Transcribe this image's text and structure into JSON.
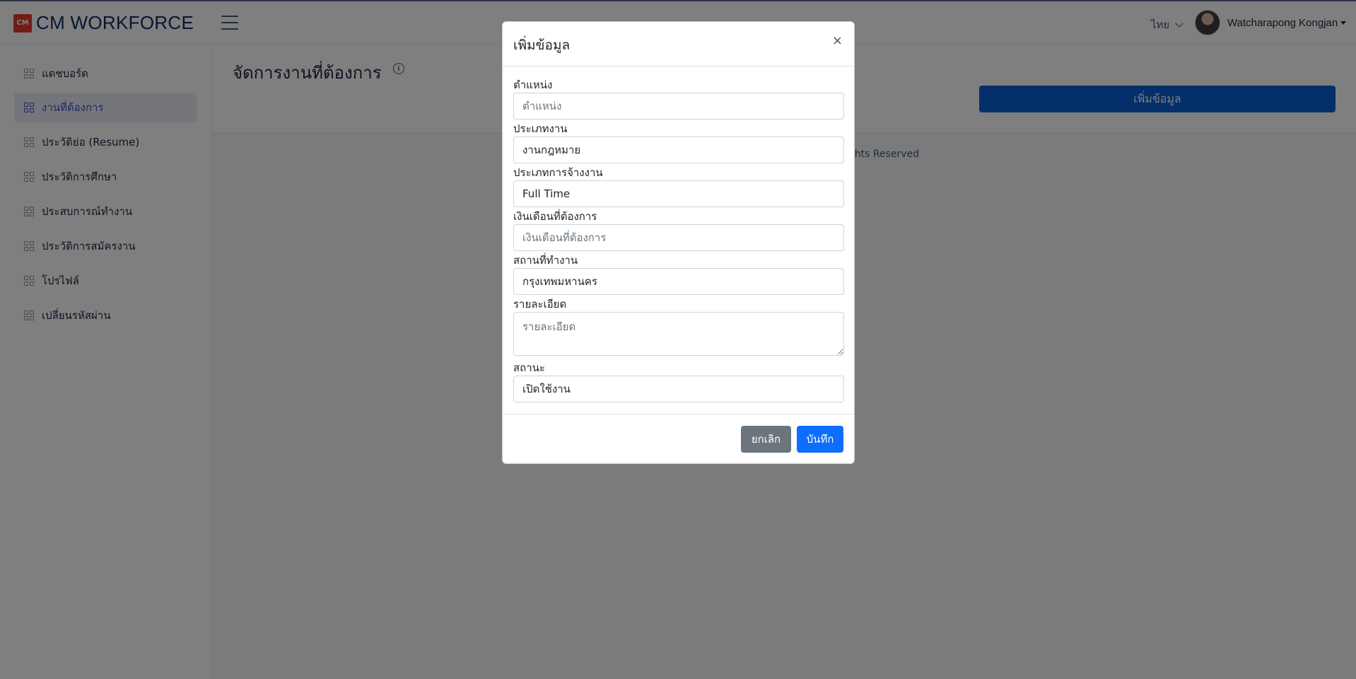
{
  "header": {
    "brand_logo": "CM",
    "brand_name": "CM WORKFORCE",
    "language": "ไทย",
    "user_name": "Watcharapong Kongjan"
  },
  "sidebar": {
    "items": [
      {
        "label": "แดชบอร์ด",
        "active": false
      },
      {
        "label": "งานที่ต้องการ",
        "active": true
      },
      {
        "label": "ประวัติย่อ (Resume)",
        "active": false
      },
      {
        "label": "ประวัติการศึกษา",
        "active": false
      },
      {
        "label": "ประสบการณ์ทำงาน",
        "active": false
      },
      {
        "label": "ประวัติการสมัครงาน",
        "active": false
      },
      {
        "label": "โปรไฟล์",
        "active": false
      },
      {
        "label": "เปลี่ยนรหัสผ่าน",
        "active": false
      }
    ]
  },
  "main": {
    "page_title": "จัดการงานที่ต้องการ",
    "add_button": "เพิ่มข้อมูล",
    "footer_text": "hts Reserved"
  },
  "modal": {
    "title": "เพิ่มข้อมูล",
    "close": "×",
    "fields": {
      "position": {
        "label": "ตำแหน่ง",
        "value": "",
        "placeholder": "ตำแหน่ง"
      },
      "job_type": {
        "label": "ประเภทงาน",
        "value": "งานกฎหมาย",
        "placeholder": ""
      },
      "employment_type": {
        "label": "ประเภทการจ้างงาน",
        "value": "Full Time",
        "placeholder": ""
      },
      "salary": {
        "label": "เงินเดือนที่ต้องการ",
        "value": "",
        "placeholder": "เงินเดือนที่ต้องการ"
      },
      "location": {
        "label": "สถานที่ทำงาน",
        "value": "กรุงเทพมหานคร",
        "placeholder": ""
      },
      "details": {
        "label": "รายละเอียด",
        "value": "",
        "placeholder": "รายละเอียด"
      },
      "status": {
        "label": "สถานะ",
        "value": "เปิดใช้งาน",
        "placeholder": ""
      }
    },
    "cancel_button": "ยกเลิก",
    "save_button": "บันทึก"
  },
  "colors": {
    "brand": "#e23a2d",
    "primary": "#0d6efd",
    "secondary": "#6c757d",
    "sidebar_active": "#3f51b5"
  }
}
